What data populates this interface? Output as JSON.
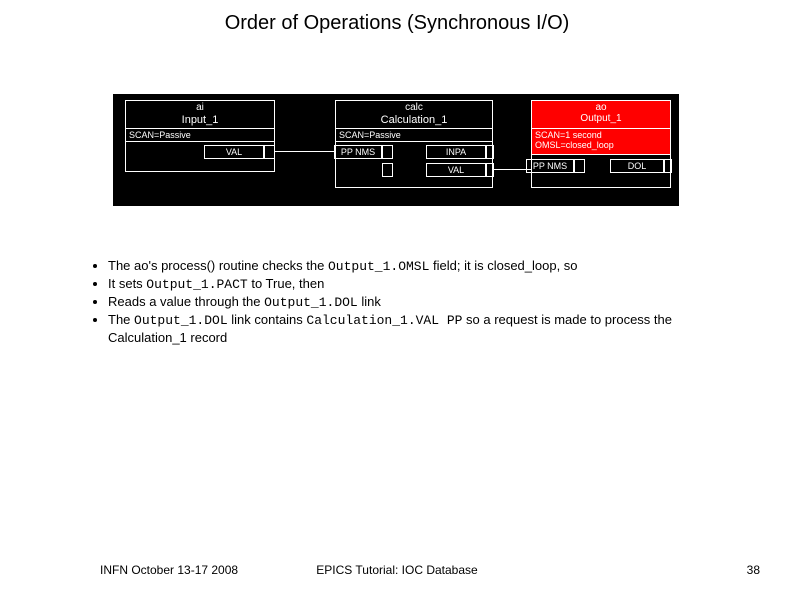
{
  "title": "Order of Operations (Synchronous I/O)",
  "diagram": {
    "block1": {
      "type": "ai",
      "name": "Input_1",
      "meta": "SCAN=Passive",
      "field": "VAL"
    },
    "block2": {
      "type": "calc",
      "name": "Calculation_1",
      "meta": "SCAN=Passive",
      "ppnms": "PP NMS",
      "inpa": "INPA",
      "val": "VAL"
    },
    "block3": {
      "type": "ao",
      "name": "Output_1",
      "meta1": "SCAN=1 second",
      "meta2": "OMSL=closed_loop",
      "ppnms": "PP NMS",
      "dol": "DOL"
    }
  },
  "bullets": {
    "b1a": "The ao's process() routine checks the ",
    "b1code": "Output_1.OMSL",
    "b1b": " field; it is closed_loop, so",
    "b2a": "It sets ",
    "b2code": "Output_1.PACT",
    "b2b": " to True, then",
    "b3a": "Reads a value through the ",
    "b3code": "Output_1.DOL",
    "b3b": " link",
    "b4a": "The ",
    "b4code1": "Output_1.DOL",
    "b4b": " link contains ",
    "b4code2": "Calculation_1.VAL PP",
    "b4c": " so a request is made to process the Calculation_1 record"
  },
  "footer": {
    "left": "INFN October 13-17 2008",
    "center": "EPICS Tutorial: IOC Database",
    "right": "38"
  }
}
